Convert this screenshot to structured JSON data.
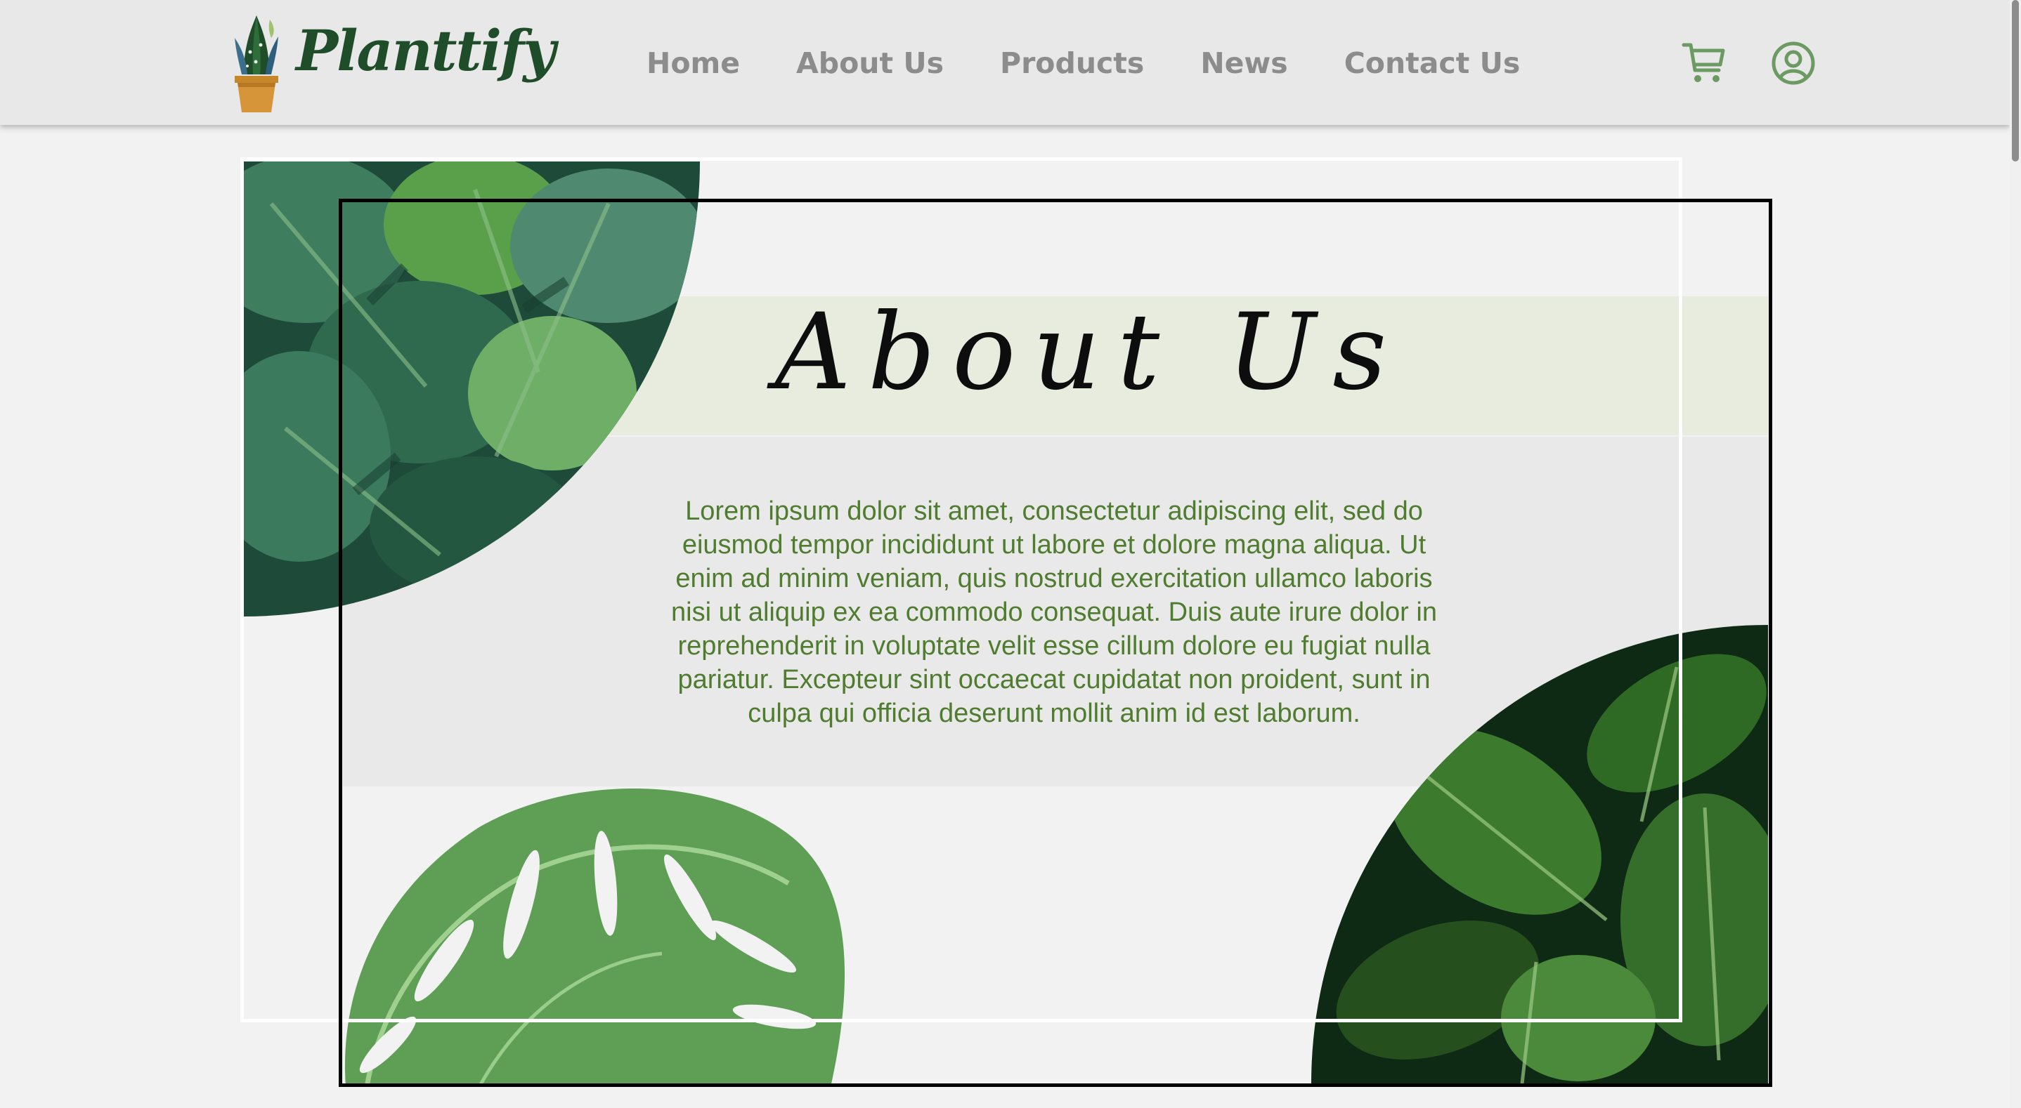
{
  "brand": {
    "name": "Planttify"
  },
  "nav": {
    "items": [
      {
        "label": "Home"
      },
      {
        "label": "About Us"
      },
      {
        "label": "Products"
      },
      {
        "label": "News"
      },
      {
        "label": "Contact Us"
      }
    ]
  },
  "header_icons": {
    "cart": "shopping-cart-icon",
    "account": "user-circle-icon"
  },
  "hero": {
    "title": "About Us",
    "body": "Lorem ipsum dolor sit amet, consectetur adipiscing elit, sed do eiusmod tempor incididunt ut labore et dolore magna aliqua. Ut enim ad minim veniam, quis nostrud exercitation ullamco laboris nisi ut aliquip ex ea commodo consequat. Duis aute irure dolor in reprehenderit in voluptate velit esse cillum dolore eu fugiat nulla pariatur. Excepteur sint occaecat cupidatat non proident, sunt in culpa qui officia deserunt mollit anim id est laborum."
  },
  "colors": {
    "page_bg": "#f2f2f2",
    "header_bg": "#e8e8e8",
    "nav_text": "#8c8c8c",
    "icon_green": "#6c9a63",
    "brand_green": "#1f4d2a",
    "body_text": "#4f7c2e",
    "title_band": "#e8ecdf"
  }
}
